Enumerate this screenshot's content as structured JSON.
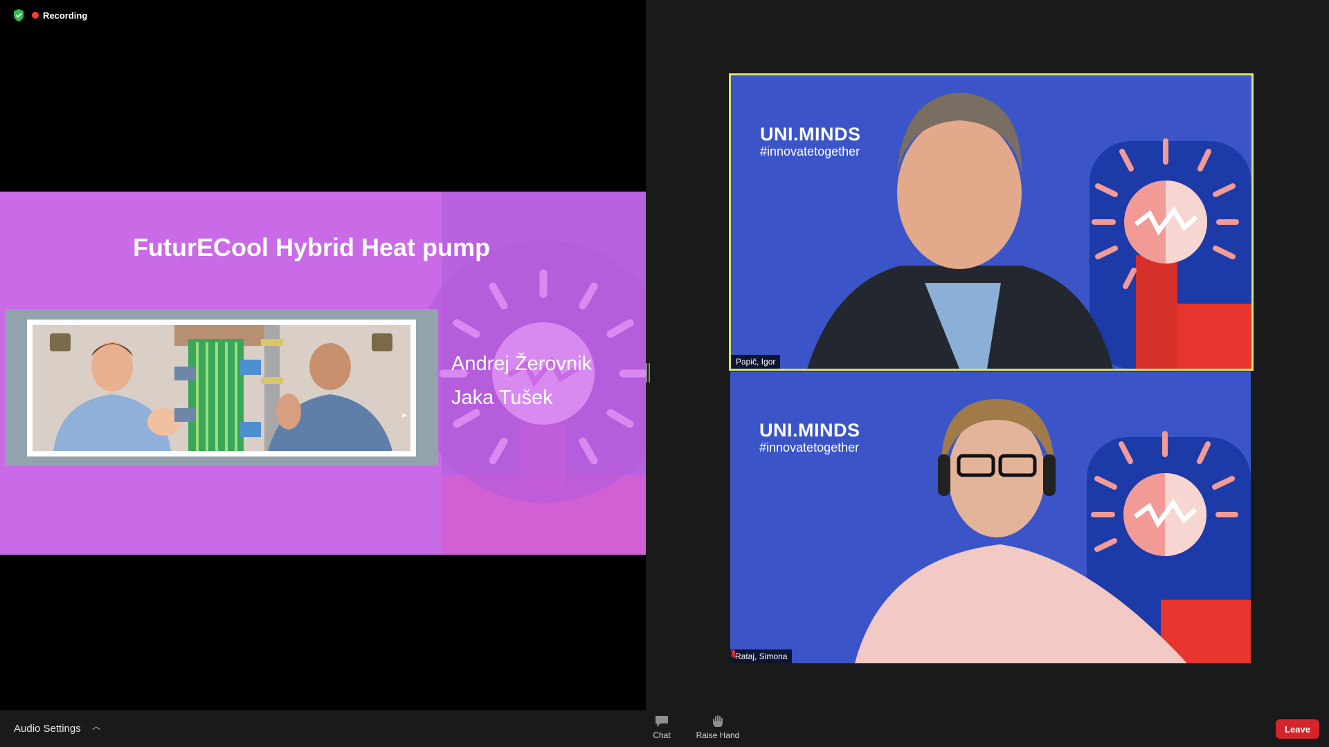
{
  "recording": {
    "label": "Recording",
    "shield_icon": "shield-check-icon",
    "dot_color": "#ff3b30"
  },
  "slide": {
    "title": "FuturECool Hybrid Heat pump",
    "authors": [
      "Andrej Žerovnik",
      "Jaka Tušek"
    ],
    "background_color": "#c96be6"
  },
  "participants": [
    {
      "name": "Papič, Igor",
      "active_speaker": true,
      "muted": false,
      "brand": "UNI.MINDS",
      "hashtag": "#innovatetogether"
    },
    {
      "name": "Rataj, Simona",
      "active_speaker": false,
      "muted": true,
      "brand": "UNI.MINDS",
      "hashtag": "#innovatetogether"
    }
  ],
  "toolbar": {
    "audio_settings_label": "Audio Settings",
    "chat_label": "Chat",
    "raise_hand_label": "Raise Hand",
    "leave_label": "Leave"
  },
  "colors": {
    "accent_speaker_border": "#d7e36c",
    "leave": "#d4252c",
    "tile_background": "#3b55c8"
  }
}
